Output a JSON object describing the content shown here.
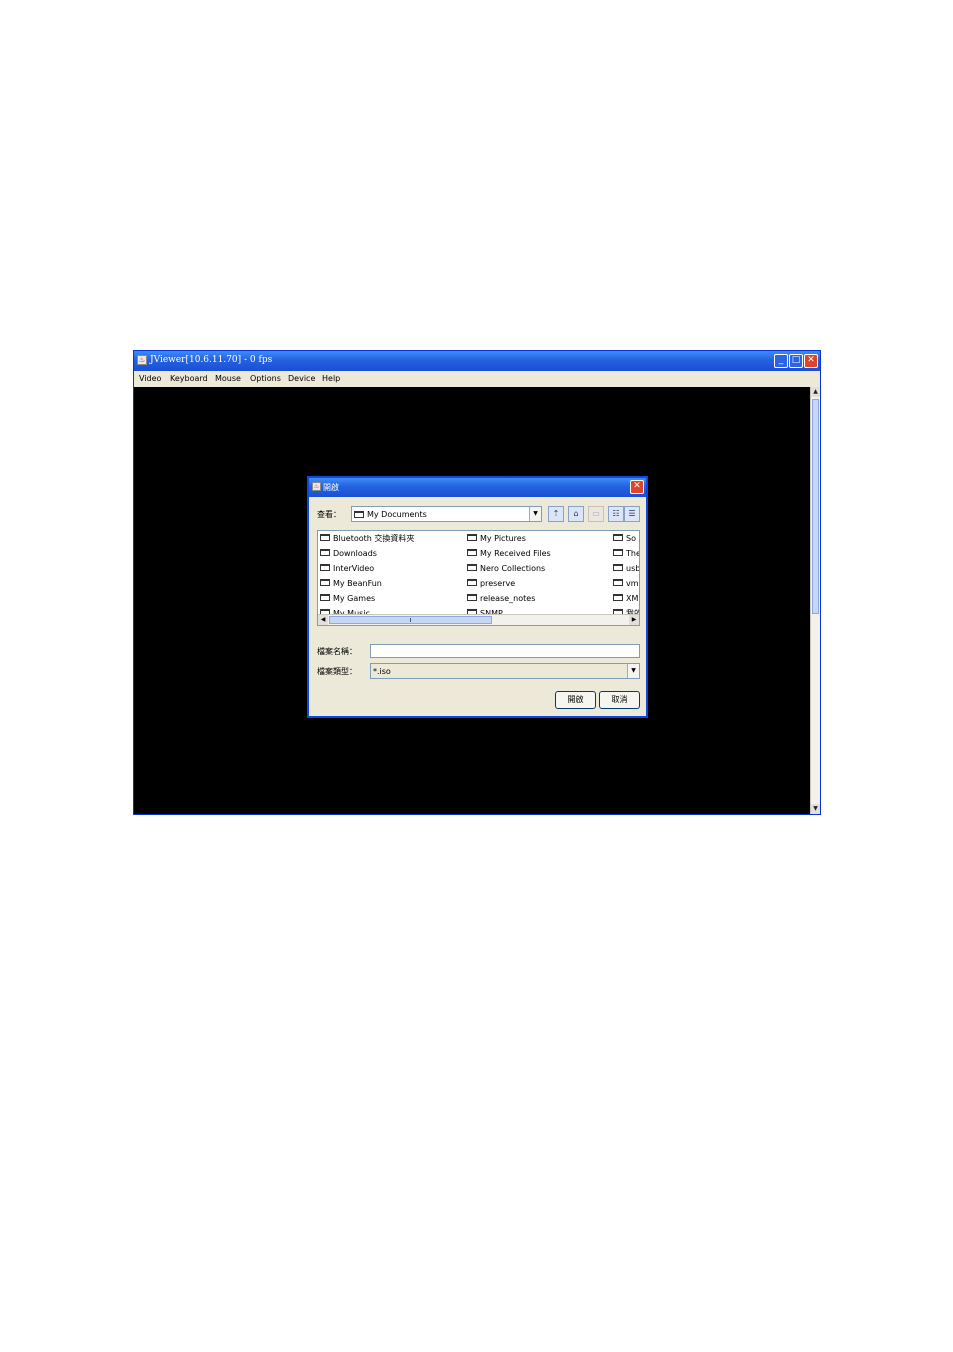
{
  "window": {
    "title": "JViewer[10.6.11.70] - 0 fps",
    "minimize_glyph": "_",
    "maximize_glyph": "□",
    "close_glyph": "✕",
    "menu": [
      "Video",
      "Keyboard",
      "Mouse",
      "Options",
      "Device",
      "Help"
    ]
  },
  "dialog": {
    "title": "開啟",
    "close_glyph": "✕",
    "look_in_label": "查看：",
    "look_in_value": "My Documents",
    "toolbar_icons": [
      "up-folder-icon",
      "home-icon",
      "new-folder-icon",
      "list-view-icon",
      "details-view-icon"
    ],
    "files": [
      [
        "Bluetooth 交換資料夾",
        "My Pictures",
        "So"
      ],
      [
        "Downloads",
        "My Received Files",
        "The"
      ],
      [
        "InterVideo",
        "Nero Collections",
        "usb"
      ],
      [
        "My BeanFun",
        "preserve",
        "vm"
      ],
      [
        "My Games",
        "release_notes",
        "XM"
      ],
      [
        "My Music",
        "SNMP",
        "我的"
      ]
    ],
    "filename_label": "檔案名稱：",
    "filename_value": "",
    "filetype_label": "檔案類型：",
    "filetype_value": "*.iso",
    "open_button": "開啟",
    "cancel_button": "取消"
  }
}
